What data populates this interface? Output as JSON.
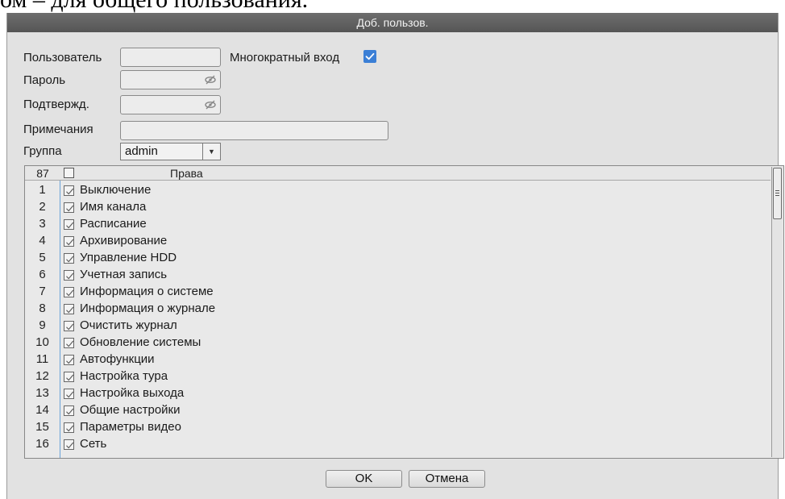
{
  "background_text": "ом – для общего пользования.",
  "dialog": {
    "title": "Доб. пользов.",
    "fields": {
      "user_label": "Пользователь",
      "user_value": "",
      "multi_login_label": "Многократный вход",
      "multi_login_checked": true,
      "password_label": "Пароль",
      "password_value": "",
      "confirm_label": "Подтвержд.",
      "confirm_value": "",
      "notes_label": "Примечания",
      "notes_value": "",
      "group_label": "Группа",
      "group_value": "admin"
    },
    "rights_table": {
      "count": "87",
      "header": "Права",
      "rows": [
        {
          "num": "1",
          "name": "Выключение",
          "checked": true
        },
        {
          "num": "2",
          "name": "Имя канала",
          "checked": true
        },
        {
          "num": "3",
          "name": "Расписание",
          "checked": true
        },
        {
          "num": "4",
          "name": "Архивирование",
          "checked": true
        },
        {
          "num": "5",
          "name": "Управление HDD",
          "checked": true
        },
        {
          "num": "6",
          "name": "Учетная запись",
          "checked": true
        },
        {
          "num": "7",
          "name": "Информация о системе",
          "checked": true
        },
        {
          "num": "8",
          "name": "Информация о журнале",
          "checked": true
        },
        {
          "num": "9",
          "name": "Очистить журнал",
          "checked": true
        },
        {
          "num": "10",
          "name": "Обновление системы",
          "checked": true
        },
        {
          "num": "11",
          "name": "Автофункции",
          "checked": true
        },
        {
          "num": "12",
          "name": "Настройка тура",
          "checked": true
        },
        {
          "num": "13",
          "name": "Настройка выхода",
          "checked": true
        },
        {
          "num": "14",
          "name": "Общие настройки",
          "checked": true
        },
        {
          "num": "15",
          "name": "Параметры видео",
          "checked": true
        },
        {
          "num": "16",
          "name": "Сеть",
          "checked": true
        }
      ]
    },
    "buttons": {
      "ok": "OK",
      "cancel": "Отмена"
    }
  },
  "icons": {
    "password_eye": "eye-slash-icon",
    "checkbox": "checkmark-icon",
    "dropdown": "triangle-down-icon"
  },
  "colors": {
    "title_bar": "#5f5f5f",
    "dialog_bg": "#e2e2e2",
    "accent_checkbox": "#3b7fd6",
    "table_separator": "#6aa3d8"
  }
}
